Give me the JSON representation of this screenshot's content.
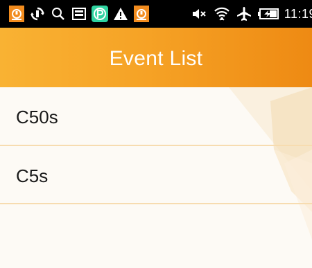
{
  "status_bar": {
    "left_icons": [
      "notification-alert-icon",
      "sync-icon",
      "search-icon",
      "storage-icon",
      "p-app-icon",
      "warning-icon",
      "notification-alert-icon"
    ],
    "right_icons": [
      "mute-icon",
      "wifi-icon",
      "airplane-icon",
      "battery-charging-icon"
    ],
    "time": "11:19"
  },
  "app_bar": {
    "title": "Event List",
    "color_start": "#f9b233",
    "color_end": "#ee8a13"
  },
  "events": [
    {
      "label": "C50s"
    },
    {
      "label": "C5s"
    }
  ],
  "colors": {
    "divider": "#f7dcb0",
    "content_bg": "#fdfaf5",
    "text": "#1a1a1a"
  }
}
